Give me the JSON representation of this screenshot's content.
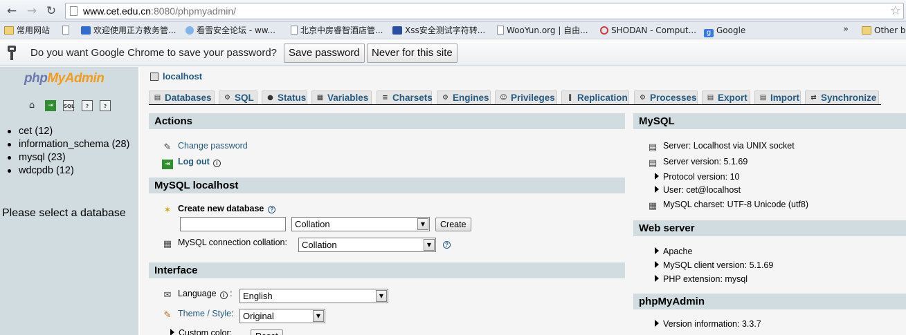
{
  "browser": {
    "url_host": "www.cet.edu.cn",
    "url_rest": ":8080/phpmyadmin/",
    "bookmarks": [
      {
        "label": "常用网站",
        "icon": "folder-icon"
      },
      {
        "label": "",
        "icon": "page-icon"
      },
      {
        "label": "欢迎使用正方教务管...",
        "icon": "zhengfang-favicon"
      },
      {
        "label": "看雪安全论坛 - ww...",
        "icon": "kanxue-favicon"
      },
      {
        "label": "北京中房睿智酒店管...",
        "icon": "page-icon"
      },
      {
        "label": "Xss安全测试字符转...",
        "icon": "paw-favicon"
      },
      {
        "label": "WooYun.org | 自由...",
        "icon": "page-icon"
      },
      {
        "label": "SHODAN - Comput...",
        "icon": "shodan-favicon"
      },
      {
        "label": "Google",
        "icon": "google-favicon"
      }
    ],
    "bookmarks_more": "»",
    "other_bookmarks": "Other bo",
    "infobar": {
      "message": "Do you want Google Chrome to save your password?",
      "save_label": "Save password",
      "never_label": "Never for this site"
    }
  },
  "left": {
    "logo_php": "php",
    "logo_my": "My",
    "logo_admin": "Admin",
    "databases": [
      "cet (12)",
      "information_schema (28)",
      "mysql (23)",
      "wdcpdb (12)"
    ],
    "prompt": "Please select a database"
  },
  "main": {
    "server": "localhost",
    "tabs": [
      "Databases",
      "SQL",
      "Status",
      "Variables",
      "Charsets",
      "Engines",
      "Privileges",
      "Replication",
      "Processes",
      "Export",
      "Import",
      "Synchronize"
    ],
    "actions": {
      "title": "Actions",
      "change_password": "Change password",
      "logout": "Log out"
    },
    "mysql_localhost": {
      "title": "MySQL localhost",
      "create_db_label": "Create new database",
      "new_db_value": "",
      "collation_placeholder": "Collation",
      "create_button": "Create",
      "connection_collation_label": "MySQL connection collation:",
      "connection_collation_value": "Collation"
    },
    "interface": {
      "title": "Interface",
      "language_label": "Language",
      "language_value": "English",
      "theme_label": "Theme / Style",
      "theme_value": "Original",
      "custom_color_label": "Custom color:",
      "reset_button": "Reset"
    },
    "mysql_info": {
      "title": "MySQL",
      "server": "Server: Localhost via UNIX socket",
      "server_version": "Server version: 5.1.69",
      "protocol_version": "Protocol version: 10",
      "user": "User: cet@localhost",
      "charset": "MySQL charset: UTF-8 Unicode (utf8)"
    },
    "web_server": {
      "title": "Web server",
      "items": [
        "Apache",
        "MySQL client version: 5.1.69",
        "PHP extension: mysql"
      ]
    },
    "pma_info": {
      "title": "phpMyAdmin",
      "version": "Version information: 3.3.7"
    }
  }
}
